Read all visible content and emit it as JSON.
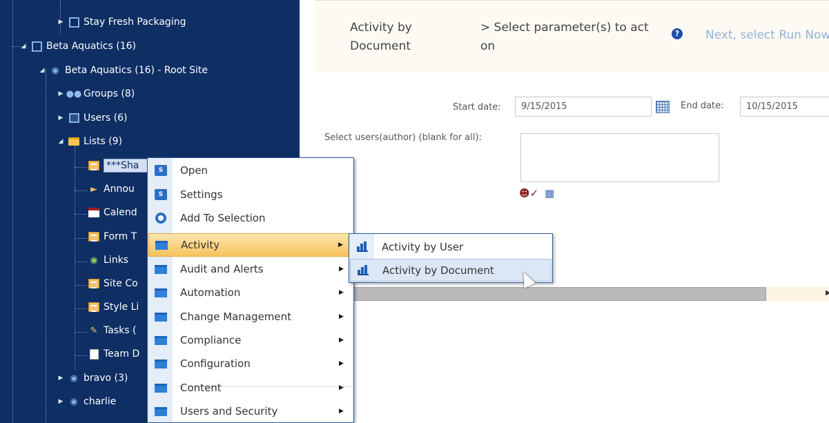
{
  "tree": {
    "nodes": [
      {
        "label": "Stay Fresh Packaging"
      },
      {
        "label": "Beta Aquatics (16)"
      },
      {
        "label": "Beta Aquatics (16) - Root Site"
      },
      {
        "label": "Groups (8)"
      },
      {
        "label": "Users (6)"
      },
      {
        "label": "Lists (9)"
      },
      {
        "label": "***Sha"
      },
      {
        "label": "Annou"
      },
      {
        "label": "Calend"
      },
      {
        "label": "Form T"
      },
      {
        "label": "Links"
      },
      {
        "label": "Site Co"
      },
      {
        "label": "Style Li"
      },
      {
        "label": "Tasks ("
      },
      {
        "label": "Team D"
      },
      {
        "label": "bravo (3)"
      },
      {
        "label": "charlie"
      }
    ]
  },
  "header": {
    "title": "Activity by Document",
    "step": "> Select parameter(s) to act on",
    "help_icon": "?",
    "next": "Next, select Run Now >"
  },
  "form": {
    "start_label": "Start date:",
    "start_value": "9/15/2015",
    "end_label": "End date:",
    "end_value": "10/15/2015",
    "users_label": "Select users(author) (blank for all):",
    "users_value": ""
  },
  "context_menu": {
    "items": [
      {
        "label": "Open",
        "icon": "sharepoint-icon"
      },
      {
        "label": "Settings",
        "icon": "sharepoint-icon"
      },
      {
        "label": "Add To Selection",
        "icon": "gear-icon"
      },
      {
        "label": "Activity",
        "icon": "folder-icon",
        "submenu": true
      },
      {
        "label": "Audit and Alerts",
        "icon": "folder-icon",
        "submenu": true
      },
      {
        "label": "Automation",
        "icon": "folder-icon",
        "submenu": true
      },
      {
        "label": "Change Management",
        "icon": "folder-icon",
        "submenu": true
      },
      {
        "label": "Compliance",
        "icon": "folder-icon",
        "submenu": true
      },
      {
        "label": "Configuration",
        "icon": "folder-icon",
        "submenu": true
      },
      {
        "label": "Content",
        "icon": "folder-icon",
        "submenu": true
      },
      {
        "label": "Users and Security",
        "icon": "folder-icon",
        "submenu": true
      }
    ]
  },
  "submenu": {
    "items": [
      {
        "label": "Activity by User",
        "icon": "bar-chart-icon"
      },
      {
        "label": "Activity by Document",
        "icon": "bar-chart-icon"
      }
    ]
  },
  "colors": {
    "tree_bg": "#0e2e64",
    "menu_hover": "#f7c25d",
    "accent": "#2b579a",
    "link": "#8fb3d6"
  }
}
